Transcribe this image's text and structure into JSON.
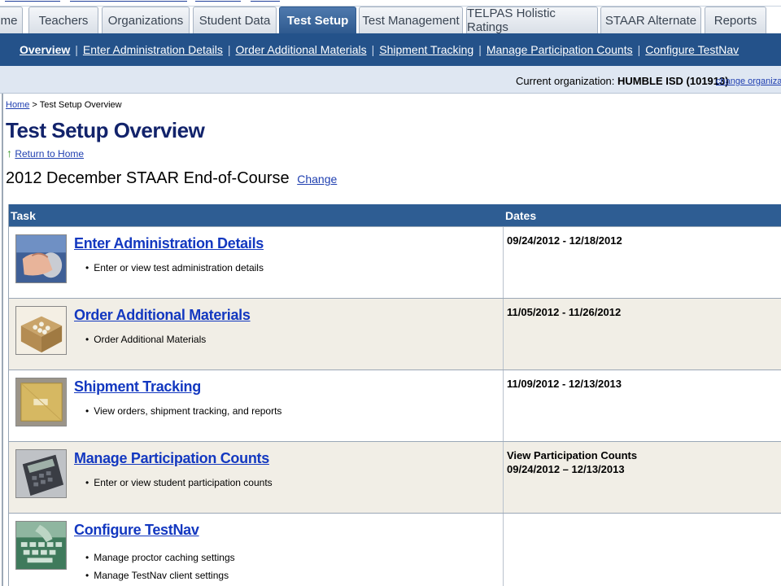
{
  "tabs": [
    {
      "label": "me",
      "active": false
    },
    {
      "label": "Teachers",
      "active": false
    },
    {
      "label": "Organizations",
      "active": false
    },
    {
      "label": "Student Data",
      "active": false
    },
    {
      "label": "Test Setup",
      "active": true
    },
    {
      "label": "Test Management",
      "active": false
    },
    {
      "label": "TELPAS Holistic Ratings",
      "active": false
    },
    {
      "label": "STAAR Alternate",
      "active": false
    },
    {
      "label": "Reports",
      "active": false
    }
  ],
  "subnav": [
    {
      "label": "Overview",
      "current": true
    },
    {
      "label": "Enter Administration Details"
    },
    {
      "label": "Order Additional Materials"
    },
    {
      "label": "Shipment Tracking"
    },
    {
      "label": "Manage Participation Counts"
    },
    {
      "label": "Configure TestNav"
    }
  ],
  "org": {
    "prefix": "Current organization:",
    "name": "HUMBLE ISD (101913)",
    "change_label": "change organization"
  },
  "breadcrumb": {
    "home": "Home",
    "separator": ">",
    "current": "Test Setup Overview"
  },
  "page_title": "Test Setup Overview",
  "return_link": "Return to Home",
  "administration": {
    "name": "2012 December STAAR End-of-Course",
    "change_label": "Change"
  },
  "table": {
    "headers": {
      "task": "Task",
      "dates": "Dates"
    },
    "rows": [
      {
        "title": "Enter Administration Details",
        "bullets": [
          "Enter or view test administration details"
        ],
        "dates": [
          "09/24/2012 - 12/18/2012"
        ],
        "icon": "computer-mouse-icon"
      },
      {
        "title": "Order Additional Materials",
        "bullets": [
          "Order Additional Materials"
        ],
        "dates": [
          "11/05/2012 - 11/26/2012"
        ],
        "icon": "box-packing-icon"
      },
      {
        "title": "Shipment Tracking",
        "bullets": [
          "View orders, shipment tracking, and reports"
        ],
        "dates": [
          "11/09/2012 - 12/13/2013"
        ],
        "icon": "envelope-package-icon"
      },
      {
        "title": "Manage Participation Counts",
        "bullets": [
          "Enter or view student participation counts"
        ],
        "dates": [
          "View Participation Counts",
          "09/24/2012 – 12/13/2013"
        ],
        "icon": "calculator-icon"
      },
      {
        "title": "Configure TestNav",
        "bullets": [
          "Manage proctor caching settings",
          "Manage TestNav client settings"
        ],
        "dates": [],
        "icon": "keyboard-icon"
      }
    ]
  },
  "colors": {
    "nav_blue": "#24528a",
    "header_blue": "#2e5d93",
    "title_navy": "#12236b",
    "link_blue": "#1338c0",
    "alt_row": "#f1eee6"
  }
}
